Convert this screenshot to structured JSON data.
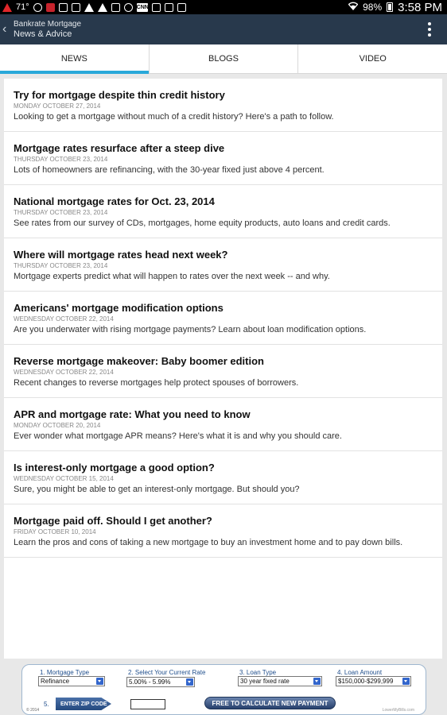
{
  "status_bar": {
    "temperature": "71°",
    "battery": "98%",
    "time": "3:58 PM",
    "cnn_label": "CNN"
  },
  "app_bar": {
    "app_name": "Bankrate Mortgage",
    "section": "News & Advice"
  },
  "tabs": [
    {
      "label": "NEWS",
      "active": true
    },
    {
      "label": "BLOGS",
      "active": false
    },
    {
      "label": "VIDEO",
      "active": false
    }
  ],
  "articles": [
    {
      "title": "Try for mortgage despite thin credit history",
      "date": "MONDAY OCTOBER 27, 2014",
      "desc": "Looking to get a mortgage without much of a credit history? Here's a path to follow."
    },
    {
      "title": "Mortgage rates resurface after a steep dive",
      "date": "THURSDAY OCTOBER 23, 2014",
      "desc": "Lots of homeowners are refinancing, with the 30-year fixed just above 4 percent."
    },
    {
      "title": "National mortgage rates for Oct. 23, 2014",
      "date": "THURSDAY OCTOBER 23, 2014",
      "desc": "See rates from our survey of CDs, mortgages, home equity products, auto loans and credit cards."
    },
    {
      "title": "Where will mortgage rates head next week?",
      "date": "THURSDAY OCTOBER 23, 2014",
      "desc": "Mortgage experts predict what will happen to rates over the next week -- and why."
    },
    {
      "title": "Americans' mortgage modification options",
      "date": "WEDNESDAY OCTOBER 22, 2014",
      "desc": "Are you underwater with rising mortgage payments? Learn about loan modification options."
    },
    {
      "title": "Reverse mortgage makeover: Baby boomer edition",
      "date": "WEDNESDAY OCTOBER 22, 2014",
      "desc": "Recent changes to reverse mortgages help protect spouses of borrowers."
    },
    {
      "title": "APR and mortgage rate: What you need to know",
      "date": "MONDAY OCTOBER 20, 2014",
      "desc": "Ever wonder what mortgage APR means? Here's what it is and why you should care."
    },
    {
      "title": "Is interest-only mortgage a good option?",
      "date": "WEDNESDAY OCTOBER 15, 2014",
      "desc": "Sure, you might be able to get an interest-only mortgage. But should you?"
    },
    {
      "title": "Mortgage paid off. Should I get another?",
      "date": "FRIDAY OCTOBER 10, 2014",
      "desc": "Learn the pros and cons of taking a new mortgage to buy an investment home and to pay down bills."
    }
  ],
  "ad": {
    "field1_label": "1. Mortgage Type",
    "field1_value": "Refinance",
    "field2_label": "2. Select Your Current Rate",
    "field2_value": "5.00% - 5.99%",
    "field3_label": "3. Loan Type",
    "field3_value": "30 year fixed rate",
    "field4_label": "4. Loan Amount",
    "field4_value": "$150,000-$299,999",
    "step5_label": "5.",
    "zip_label": "ENTER ZIP CODE",
    "calc_button": "FREE TO CALCULATE NEW PAYMENT",
    "copyright": "© 2014",
    "brand": "LowerMyBills.com"
  }
}
